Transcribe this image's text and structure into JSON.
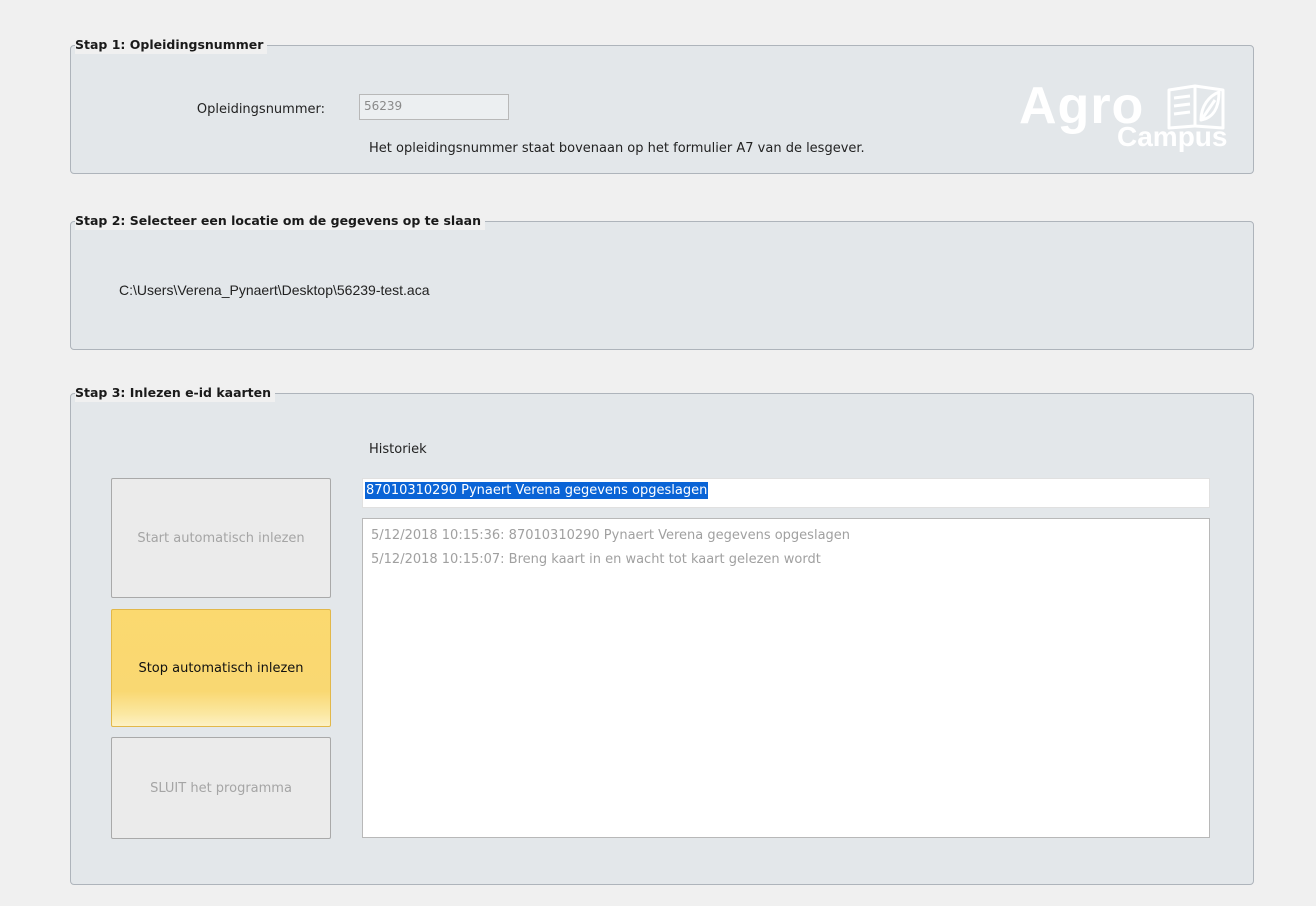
{
  "step1": {
    "title": "Stap 1: Opleidingsnummer",
    "field_label": "Opleidingsnummer:",
    "field_value": "56239",
    "hint": "Het opleidingsnummer staat bovenaan op het formulier A7 van de lesgever."
  },
  "logo": {
    "agro": "Agro",
    "campus": "Campus",
    "icon": "open-book-leaf-icon"
  },
  "step2": {
    "title": "Stap 2: Selecteer een locatie om de gegevens op te slaan",
    "path": "C:\\Users\\Verena_Pynaert\\Desktop\\56239-test.aca"
  },
  "step3": {
    "title": "Stap 3: Inlezen e-id kaarten",
    "historiek_label": "Historiek",
    "current_entry": "87010310290 Pynaert Verena gegevens opgeslagen",
    "history": [
      "5/12/2018 10:15:36:  87010310290 Pynaert Verena gegevens opgeslagen",
      "5/12/2018 10:15:07:  Breng kaart in en wacht tot kaart gelezen wordt"
    ],
    "buttons": {
      "start": "Start automatisch inlezen",
      "stop": "Stop automatisch inlezen",
      "sluit": "SLUIT het programma"
    }
  },
  "colors": {
    "panel_bg": "#e3e7ea",
    "stop_button": "#f9d872",
    "selection": "#0a64d6"
  }
}
